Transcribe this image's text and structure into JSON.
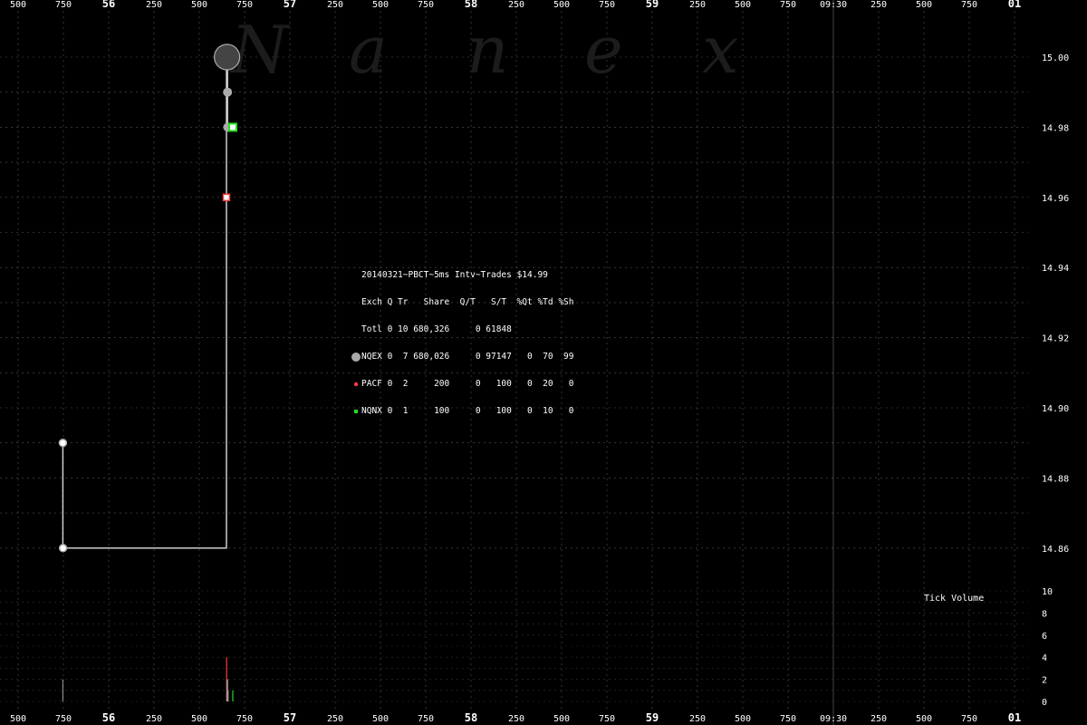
{
  "chart_data": {
    "type": "scatter",
    "watermark": "N a n e x",
    "title": "20140321~PBCT~5ms Intv~Trades $14.99",
    "y_axis": {
      "ticks": [
        "15.00",
        "14.98",
        "14.96",
        "14.94",
        "14.92",
        "14.90",
        "14.88",
        "14.86"
      ],
      "ylim": [
        14.85,
        15.01
      ]
    },
    "volume_axis": {
      "label": "Tick Volume",
      "ticks": [
        "10",
        "8",
        "6",
        "4",
        "2",
        "0"
      ],
      "ylim": [
        0,
        10
      ]
    },
    "x_axis": {
      "tick_labels": [
        "500",
        "750",
        "56",
        "250",
        "500",
        "750",
        "57",
        "250",
        "500",
        "750",
        "58",
        "250",
        "500",
        "750",
        "59",
        "250",
        "500",
        "750",
        "09:30",
        "250",
        "500",
        "750",
        "01"
      ],
      "major_labels": [
        "56",
        "57",
        "58",
        "59",
        "01"
      ],
      "time_label": "09:30"
    },
    "legend": {
      "header": "Exch Q Tr   Share  Q/T   S/T  %Qt %Td %Sh",
      "rows": [
        {
          "text": "Totl 0 10 680,326     0 61848",
          "marker": "none",
          "color": ""
        },
        {
          "text": "NQEX 0  7 680,026     0 97147   0  70  99",
          "marker": "big-circle",
          "color": "#aaaaaa"
        },
        {
          "text": "PACF 0  2     200     0   100   0  20   0",
          "marker": "small-dot",
          "color": "#ff3b3b"
        },
        {
          "text": "NQNX 0  1     100     0   100   0  10   0",
          "marker": "small-square",
          "color": "#22dd22"
        }
      ]
    },
    "series": [
      {
        "name": "NQEX",
        "color": "#aaaaaa",
        "points": [
          {
            "t": 0.247,
            "price": 14.89
          },
          {
            "t": 0.248,
            "price": 14.86
          },
          {
            "t": 1.153,
            "price": 15.0
          },
          {
            "t": 1.156,
            "price": 14.99
          },
          {
            "t": 1.157,
            "price": 14.98
          },
          {
            "t": 1.16,
            "price": 14.98
          }
        ]
      },
      {
        "name": "PACF",
        "color": "#ff3b3b",
        "points": [
          {
            "t": 1.15,
            "price": 14.96
          }
        ]
      },
      {
        "name": "NQNX",
        "color": "#22dd22",
        "points": [
          {
            "t": 1.185,
            "price": 14.98
          }
        ]
      }
    ],
    "price_path": [
      {
        "t": 0.247,
        "price": 14.89
      },
      {
        "t": 0.247,
        "price": 14.86
      },
      {
        "t": 1.15,
        "price": 14.86
      },
      {
        "t": 1.15,
        "price": 14.96
      },
      {
        "t": 1.15,
        "price": 15.0
      },
      {
        "t": 1.156,
        "price": 15.0
      },
      {
        "t": 1.156,
        "price": 14.98
      }
    ],
    "volume_bars": [
      {
        "t": 0.247,
        "value": 2,
        "color": "#888888"
      },
      {
        "t": 1.151,
        "value": 4,
        "color": "#ff3b3b"
      },
      {
        "t": 1.153,
        "value": 2,
        "color": "#999999"
      },
      {
        "t": 1.156,
        "value": 2,
        "color": "#999999"
      },
      {
        "t": 1.159,
        "value": 1,
        "color": "#999999"
      },
      {
        "t": 1.185,
        "value": 1,
        "color": "#22dd22"
      }
    ],
    "grid": true,
    "colors": {
      "background": "#000000",
      "grid": "#555555",
      "axis_text": "#ffffff",
      "line": "#cccccc",
      "watermark": "#1c1c1c"
    }
  }
}
